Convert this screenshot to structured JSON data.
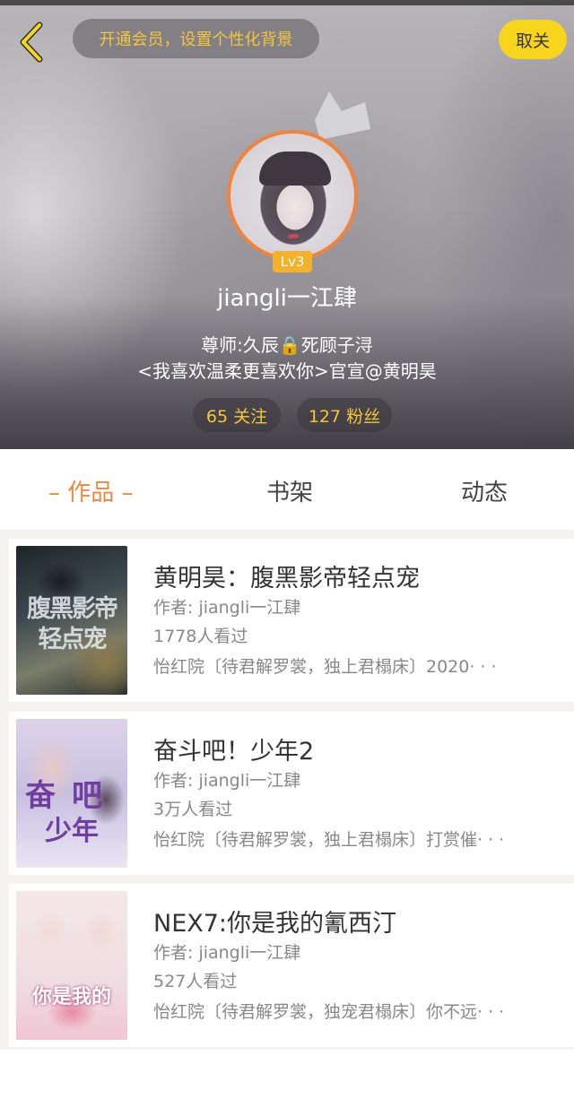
{
  "header": {
    "vip_banner": "开通会员，设置个性化背景",
    "follow_button": "取关",
    "level": "Lv3",
    "username": "jiangli一江肆",
    "bio_line1": "尊师:久辰🔒死顾子浔",
    "bio_line2": "<我喜欢温柔更喜欢你>官宣@黄明昊",
    "following": "65 关注",
    "fans": "127 粉丝"
  },
  "icons": {
    "back": "chevron-left-icon",
    "crown": "crown-icon"
  },
  "colors": {
    "accent": "#f0873f",
    "gold_text": "#f5c63a",
    "follow_button_bg": "#f6d51c",
    "level_badge_bg": "#f3b12c",
    "avatar_border": "#f0843c"
  },
  "tabs": [
    {
      "label": "– 作品 –",
      "active": true
    },
    {
      "label": "书架",
      "active": false
    },
    {
      "label": "动态",
      "active": false
    }
  ],
  "works": [
    {
      "title": "黄明昊：腹黑影帝轻点宠",
      "author": "作者: jiangli一江肆",
      "views": "1778人看过",
      "desc": "怡红院〔待君解罗裳，独上君榻床〕2020· · ·",
      "cover_line1": "腹黑影帝",
      "cover_line2": "轻点宠"
    },
    {
      "title": "奋斗吧！少年2",
      "author": "作者: jiangli一江肆",
      "views": "3万人看过",
      "desc": "怡红院〔待君解罗裳，独上君榻床〕打赏催· · ·",
      "cover_line1": "奋吧",
      "cover_line2": "少年"
    },
    {
      "title": "NEX7:你是我的氰西汀",
      "author": "作者: jiangli一江肆",
      "views": "527人看过",
      "desc": "怡红院〔待君解罗裳，独宠君榻床〕你不远· · ·",
      "cover_line1": "你是我的"
    }
  ]
}
